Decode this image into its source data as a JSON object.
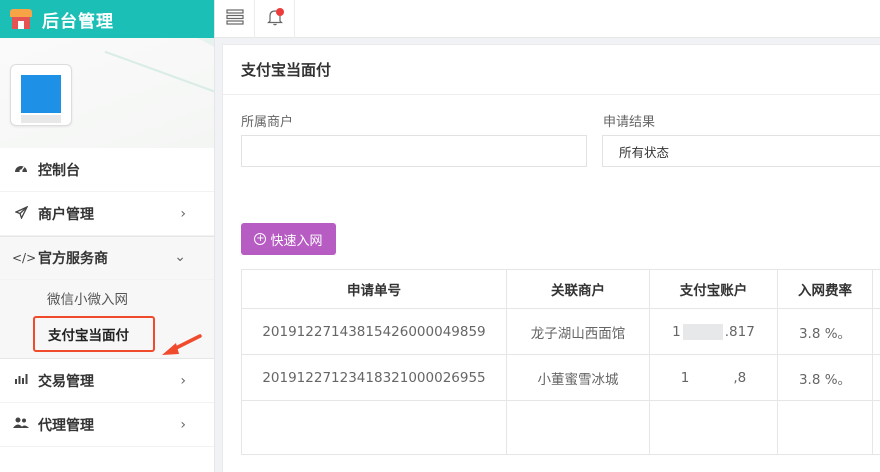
{
  "brand": {
    "title": "后台管理"
  },
  "sidebar": {
    "items": [
      {
        "label": "控制台",
        "icon": "dashboard-icon"
      },
      {
        "label": "商户管理",
        "icon": "send-icon",
        "expandable": true
      },
      {
        "label": "官方服务商",
        "icon": "code-icon",
        "expanded": true,
        "children": [
          {
            "label": "微信小微入网"
          },
          {
            "label": "支付宝当面付",
            "active": true
          }
        ]
      },
      {
        "label": "交易管理",
        "icon": "bar-chart-icon",
        "expandable": true
      },
      {
        "label": "代理管理",
        "icon": "users-icon",
        "expandable": true
      }
    ]
  },
  "topbar": {
    "icons": [
      "list-icon",
      "bell-icon"
    ]
  },
  "page": {
    "title": "支付宝当面付",
    "filters": {
      "merchant_label": "所属商户",
      "merchant_value": "",
      "result_label": "申请结果",
      "result_value": "所有状态"
    },
    "quick_join_label": "快速入网",
    "table": {
      "headers": [
        "申请单号",
        "关联商户",
        "支付宝账户",
        "入网费率"
      ],
      "rows": [
        {
          "id": "20191227143815426000049859",
          "merchant": "龙子湖山西面馆",
          "account_prefix": "1",
          "account_suffix": ".817",
          "rate": "3.8 %。"
        },
        {
          "id": "20191227123418321000026955",
          "merchant": "小董蜜雪冰城",
          "account_prefix": "1",
          "account_suffix": ",8",
          "rate": "3.8 %。"
        }
      ]
    }
  },
  "colors": {
    "brand": "#1bbfb6",
    "primary_button": "#b65cc3",
    "highlight": "#f04b2d"
  }
}
